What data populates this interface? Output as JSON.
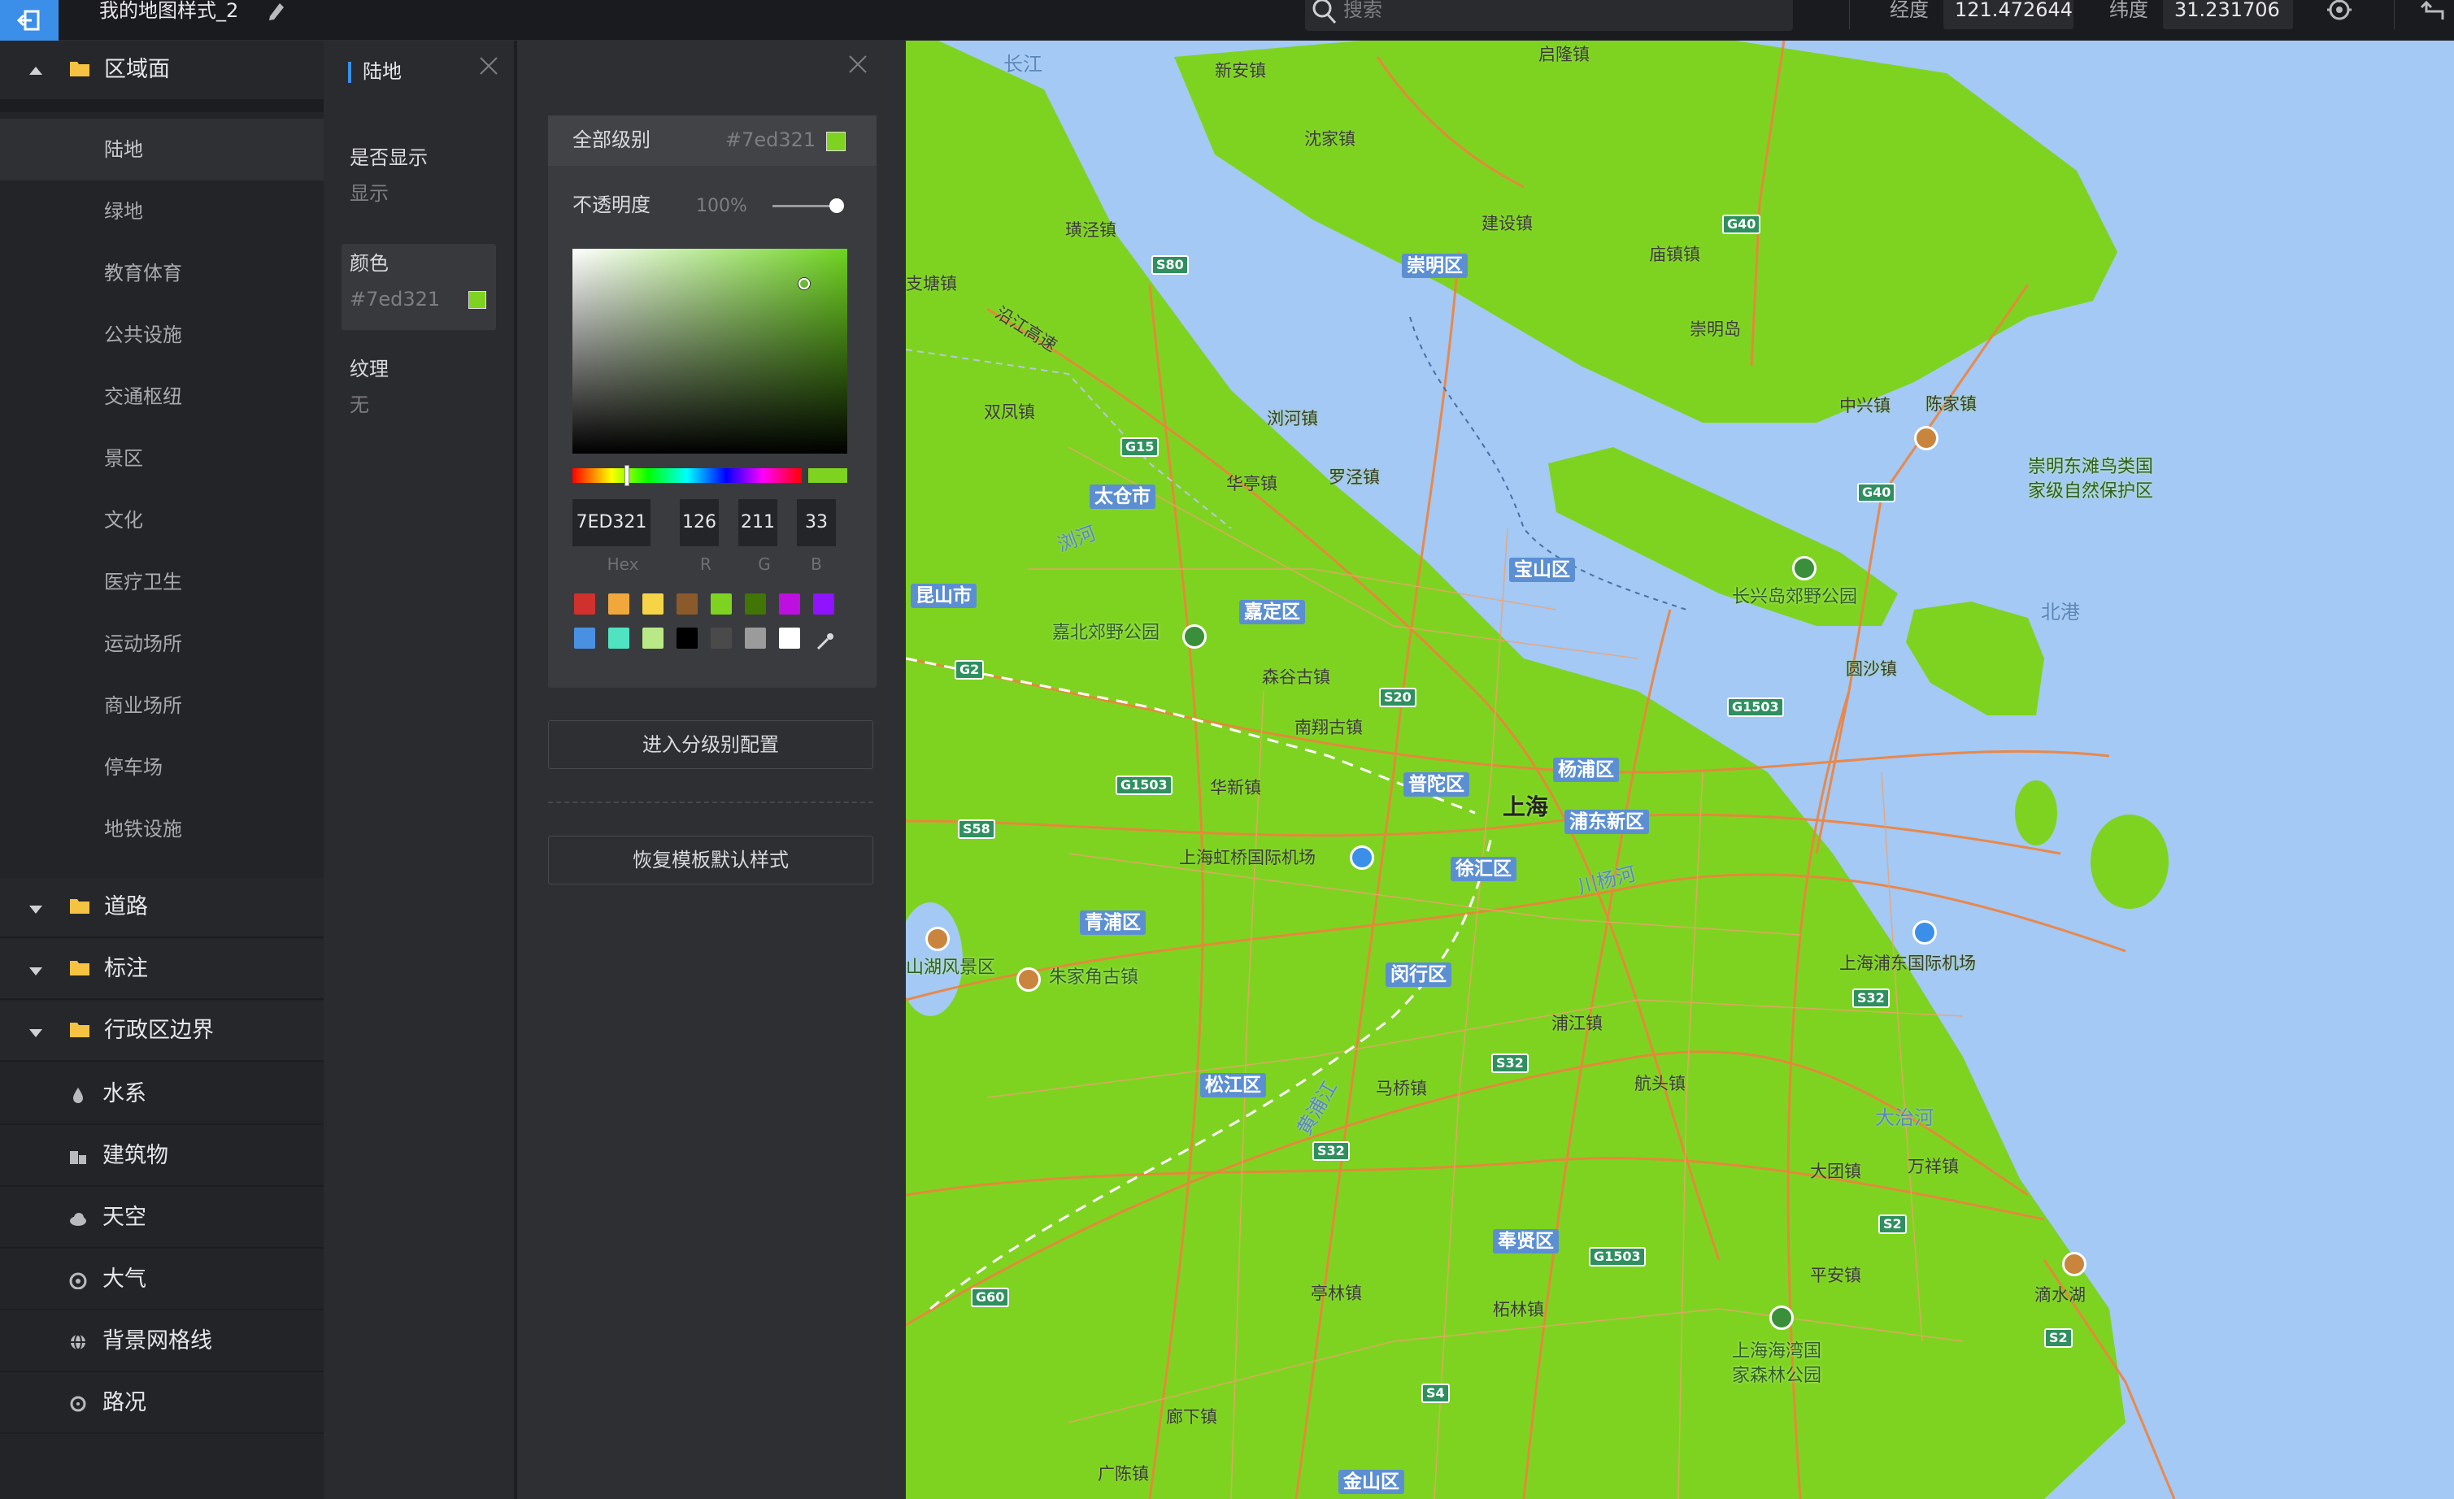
{
  "topbar": {
    "title": "我的地图样式_2",
    "search_placeholder": "搜索",
    "lng_label": "经度",
    "lng_value": "121.472644",
    "lat_label": "纬度",
    "lat_value": "31.231706"
  },
  "left_panel": {
    "groups": [
      {
        "label": "区域面",
        "expanded": true
      },
      {
        "label": "道路",
        "expanded": false
      },
      {
        "label": "标注",
        "expanded": false
      },
      {
        "label": "行政区边界",
        "expanded": false
      }
    ],
    "area_items": [
      "陆地",
      "绿地",
      "教育体育",
      "公共设施",
      "交通枢纽",
      "景区",
      "文化",
      "医疗卫生",
      "运动场所",
      "商业场所",
      "停车场",
      "地铁设施"
    ],
    "active_item": "陆地",
    "single_items": [
      {
        "label": "水系",
        "icon": "water-drop-icon"
      },
      {
        "label": "建筑物",
        "icon": "building-icon"
      },
      {
        "label": "天空",
        "icon": "cloud-icon"
      },
      {
        "label": "大气",
        "icon": "atmosphere-icon"
      },
      {
        "label": "背景网格线",
        "icon": "globe-grid-icon"
      },
      {
        "label": "路况",
        "icon": "traffic-icon"
      }
    ]
  },
  "mid_panel": {
    "title": "陆地",
    "visible_label": "是否显示",
    "visible_value": "显示",
    "color_label": "颜色",
    "color_value": "#7ed321",
    "texture_label": "纹理",
    "texture_value": "无"
  },
  "color_panel": {
    "level_label": "全部级别",
    "level_hex": "#7ed321",
    "opacity_label": "不透明度",
    "opacity_value": "100%",
    "opacity_fraction": 1.0,
    "hex_value": "7ED321",
    "r": "126",
    "g": "211",
    "b": "33",
    "hex_caption": "Hex",
    "r_caption": "R",
    "g_caption": "G",
    "b_caption": "B",
    "presets_row1": [
      "#d0312d",
      "#f0a83c",
      "#f5d547",
      "#8b5a2b",
      "#7ed321",
      "#417505",
      "#bd10e0",
      "#9013fe"
    ],
    "presets_row2": [
      "#4a90e2",
      "#50e3c2",
      "#b8e986",
      "#000000",
      "#4a4a4a",
      "#9b9b9b",
      "#ffffff"
    ],
    "level_config_button": "进入分级别配置",
    "restore_button": "恢复模板默认样式"
  },
  "map": {
    "land_color": "#7ed321",
    "water_color": "#a3c9f4",
    "road_color": "#f0823c",
    "labels": {
      "changjiang": "长江",
      "xinan": "新安镇",
      "qilong": "启隆镇",
      "shenjia": "沈家镇",
      "huangjing": "璜泾镇",
      "chongming_dist": "崇明区",
      "jianshe": "建设镇",
      "miaozhen": "庙镇镇",
      "chongming_island": "崇明岛",
      "zhixing": "支塘镇",
      "yanjiang": "沿江高速",
      "shuangfeng": "双凤镇",
      "liuhe": "浏河镇",
      "taicang": "太仓市",
      "huating": "华亭镇",
      "luojing": "罗泾镇",
      "liuhe_river": "浏河",
      "zhongxing": "中兴镇",
      "chenjia": "陈家镇",
      "dongtan": "崇明东滩鸟类国",
      "dongtan2": "家级自然保护区",
      "kunshan": "昆山市",
      "baoshan": "宝山区",
      "jiading": "嘉定区",
      "jiabei": "嘉北郊野公园",
      "changxing": "长兴岛郊野公园",
      "beigang": "北港",
      "yuanshao": "圆沙镇",
      "nanxiang_park": "森谷古镇",
      "nanxiang": "南翔古镇",
      "huaxin": "华新镇",
      "putuo": "普陀区",
      "yangpu": "杨浦区",
      "shanghai": "上海",
      "pudong": "浦东新区",
      "hongqiao": "上海虹桥国际机场",
      "xuhui": "徐汇区",
      "chuanyang": "川杨河",
      "qingpu": "青浦区",
      "dianshan": "山湖风景区",
      "zhujiajiao": "朱家角古镇",
      "minhang": "闵行区",
      "pudong_airport": "上海浦东国际机场",
      "pujiang": "浦江镇",
      "songjiang": "松江区",
      "maqiao": "马桥镇",
      "hangtou": "航头镇",
      "dazhi": "大治河",
      "datuan": "大团镇",
      "wanxiang": "万祥镇",
      "fengxian": "奉贤区",
      "tinglin": "亭林镇",
      "zhelin": "柘林镇",
      "pingan": "平安镇",
      "dishui": "滴水湖",
      "haiwan": "上海海湾国",
      "haiwan2": "家森林公园",
      "langxia": "廊下镇",
      "guangchen": "广陈镇",
      "jinshan": "金山区",
      "huangpu_river": "黄浦江"
    },
    "highways": [
      "G40",
      "S80",
      "G15",
      "G2",
      "S20",
      "G1503",
      "S58",
      "S32",
      "S4",
      "G60",
      "S2"
    ]
  }
}
